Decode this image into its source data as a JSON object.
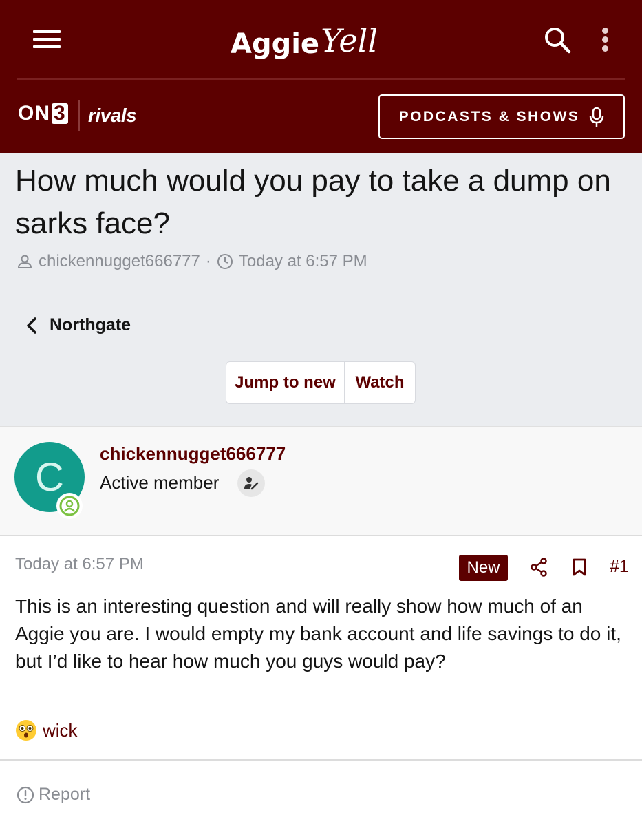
{
  "header": {
    "logo_primary": "Aggie",
    "logo_script": "Yell",
    "brand_on": "ON",
    "brand_three": "3",
    "brand_partner": "rivals",
    "podcasts_label": "PODCASTS & SHOWS",
    "colors": {
      "primary": "#5c0000",
      "text": "#ffffff"
    }
  },
  "thread": {
    "title": "How much would you pay to take a dump on sarks face?",
    "author": "chickennugget666777",
    "timestamp": "Today at 6:57 PM",
    "meta_separator": "·",
    "forum": "Northgate",
    "jump_label": "Jump to new",
    "watch_label": "Watch"
  },
  "post": {
    "avatar_letter": "C",
    "avatar_color": "#129c8c",
    "username": "chickennugget666777",
    "member_title": "Active member",
    "date": "Today at 6:57 PM",
    "new_badge": "New",
    "post_number": "#1",
    "body": "This is an interesting question and will really show how much of an Aggie you are. I would empty my bank account and life savings to do it, but I’d like to hear how much you guys would pay?",
    "reaction": {
      "emoji": "flushed-face",
      "user": "wick"
    },
    "report_label": "Report"
  },
  "icons": [
    "menu-icon",
    "search-icon",
    "more-vertical-icon",
    "microphone-icon",
    "user-icon",
    "clock-icon",
    "chevron-left-icon",
    "online-icon",
    "member-badge-icon",
    "share-icon",
    "bookmark-icon",
    "alert-circle-icon"
  ]
}
